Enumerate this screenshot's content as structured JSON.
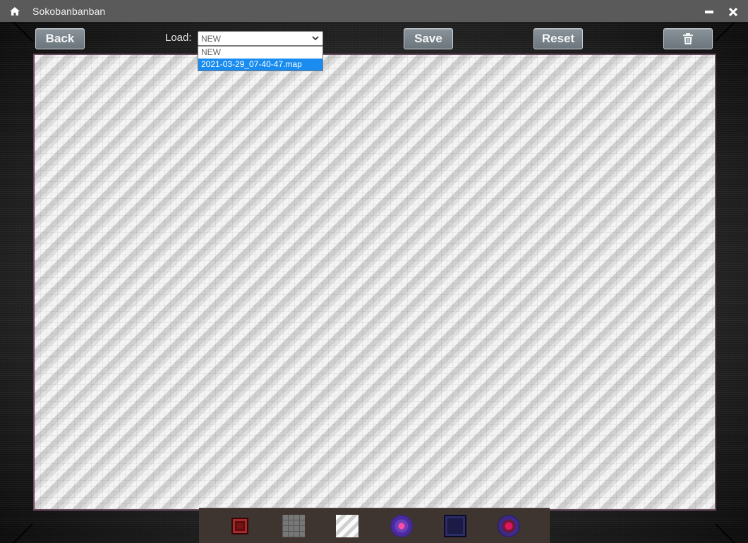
{
  "window": {
    "title": "Sokobanbanban",
    "home_icon": "home-icon",
    "minimize_icon": "minimize-icon",
    "close_icon": "close-icon"
  },
  "toolbar": {
    "back_label": "Back",
    "load_label": "Load:",
    "save_label": "Save",
    "reset_label": "Reset",
    "delete_icon": "trash-icon"
  },
  "load_select": {
    "value": "NEW",
    "options": [
      "NEW",
      "2021-03-29_07-40-47.map"
    ],
    "highlighted": "2021-03-29_07-40-47.map"
  },
  "palette": {
    "tiles": [
      "wall",
      "floor",
      "empty",
      "goal",
      "box",
      "player"
    ]
  },
  "colors": {
    "titlebar": "#5a5a5a",
    "button": "#7b858b",
    "board_border": "#6a4a5e",
    "palette_bg": "#3f3530",
    "dropdown_highlight": "#1a8cf0"
  }
}
